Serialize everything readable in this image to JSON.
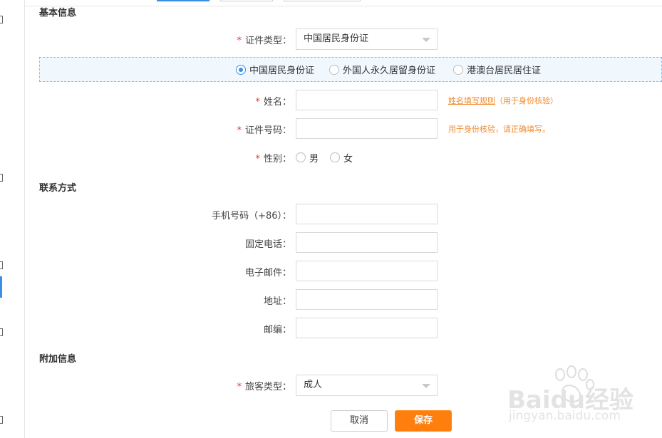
{
  "sections": {
    "basic": "基本信息",
    "contact": "联系方式",
    "extra": "附加信息"
  },
  "basic": {
    "id_type_label": "证件类型：",
    "id_type_value": "中国居民身份证",
    "id_options": [
      "中国居民身份证",
      "外国人永久居留身份证",
      "港澳台居民居住证"
    ],
    "id_selected": 0,
    "name_label": "姓名：",
    "name_hint_link": "姓名填写规则",
    "name_hint_rest": "（用于身份核验）",
    "idno_label": "证件号码：",
    "idno_hint": "用于身份核验，请正确填写。",
    "gender_label": "性别：",
    "gender_male": "男",
    "gender_female": "女"
  },
  "contact": {
    "phone_label": "手机号码（+86）：",
    "tel_label": "固定电话：",
    "email_label": "电子邮件：",
    "address_label": "地址：",
    "zip_label": "邮编："
  },
  "extra": {
    "passenger_type_label": "旅客类型：",
    "passenger_type_value": "成人"
  },
  "buttons": {
    "cancel": "取消",
    "save": "保存"
  },
  "watermark": {
    "brand": "Baidu经验",
    "url": "jingyan.baidu.com"
  },
  "colors": {
    "required": "#e4393c",
    "hint": "#f08a2c",
    "accent": "#3b8ee8",
    "save_button": "#ff7f0e"
  }
}
